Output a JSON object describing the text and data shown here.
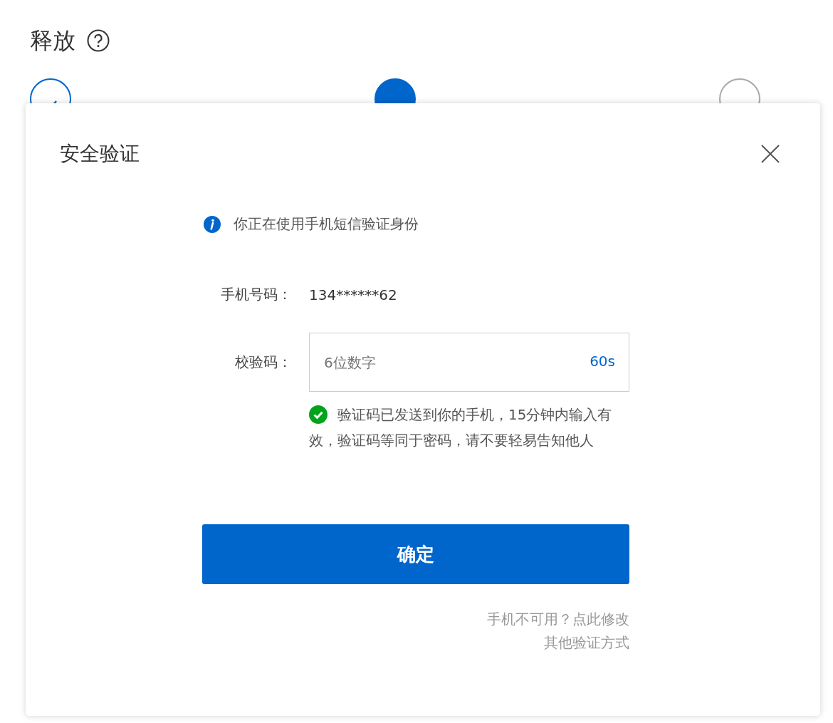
{
  "page": {
    "title": "释放"
  },
  "steps": [
    {
      "completed": true,
      "selected": false
    },
    {
      "completed": false,
      "selected": true
    },
    {
      "completed": false,
      "selected": false
    }
  ],
  "dialog": {
    "title": "安全验证",
    "notice": "你正在使用手机短信验证身份",
    "phone": {
      "label": "手机号码：",
      "value": "134******62"
    },
    "code": {
      "label": "校验码：",
      "placeholder": "6位数字",
      "countdown": "60s"
    },
    "message": {
      "kind": "success",
      "text": "验证码已发送到你的手机，15分钟内输入有效，验证码等同于密码，请不要轻易告知他人"
    },
    "confirm": "确定",
    "links": [
      "手机不可用？点此修改",
      "其他验证方式"
    ]
  }
}
